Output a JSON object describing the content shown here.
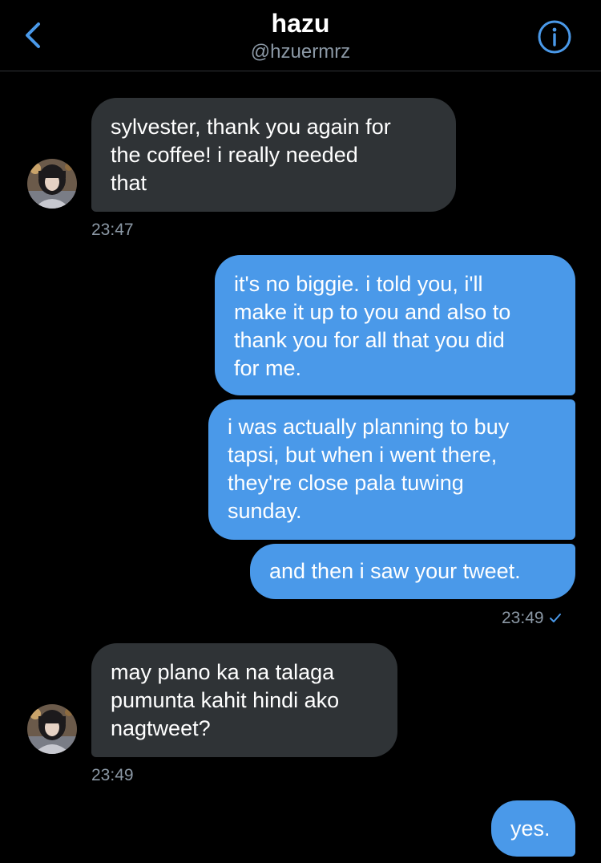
{
  "header": {
    "name": "hazu",
    "handle": "@hzuermrz"
  },
  "colors": {
    "accent": "#4a99e9",
    "incoming_bubble": "#2f3336",
    "timestamp": "#8b98a5",
    "background": "#000000"
  },
  "icons": {
    "back": "chevron-left-icon",
    "info": "info-circle-icon",
    "read_receipt": "checkmark-icon"
  },
  "messages": [
    {
      "direction": "in",
      "text": "sylvester, thank you again for\nthe coffee! i really needed\nthat"
    },
    {
      "direction": "out",
      "text": "it's no biggie. i told you, i'll\nmake it up to you and also to\nthank you for all that you did\nfor me."
    },
    {
      "direction": "out",
      "text": "i was actually planning to buy\ntapsi, but when i went there,\nthey're close pala tuwing\nsunday."
    },
    {
      "direction": "out",
      "text": "and then i saw your tweet."
    },
    {
      "direction": "in",
      "text": "may plano ka na talaga\npumunta kahit hindi ako\nnagtweet?"
    },
    {
      "direction": "out",
      "text": "yes."
    }
  ],
  "timestamps": {
    "t1": "23:47",
    "t2": "23:49",
    "t3": "23:49"
  }
}
